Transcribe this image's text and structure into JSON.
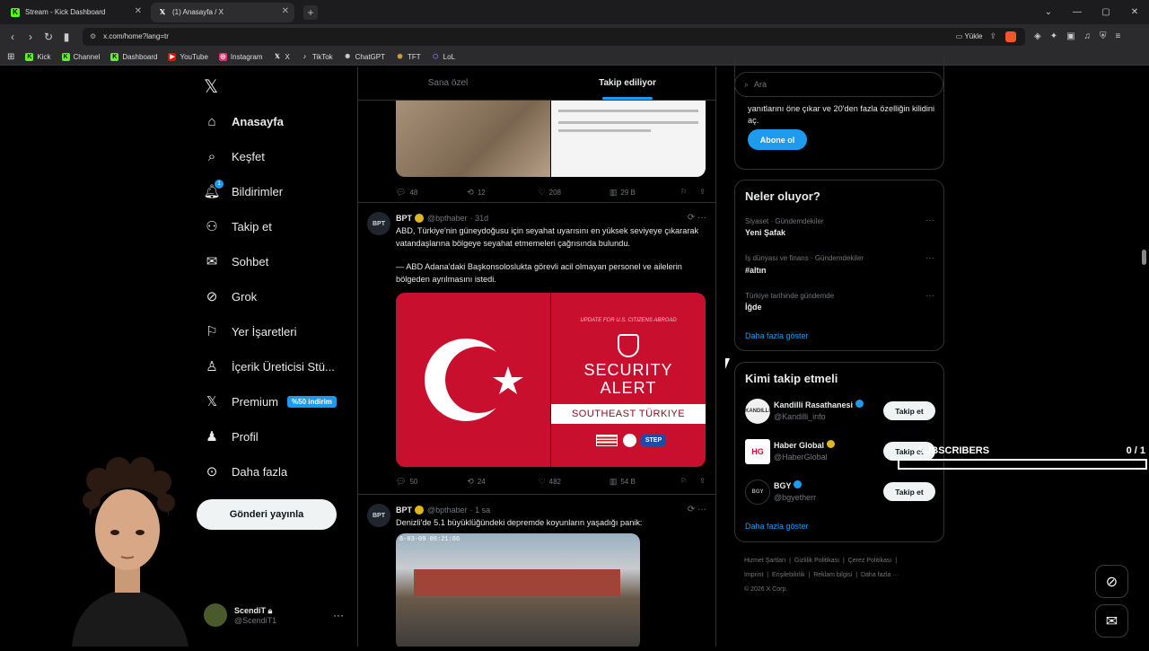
{
  "browser": {
    "tabs": [
      {
        "title": "Stream - Kick Dashboard",
        "icon": "kick-icon",
        "active": false
      },
      {
        "title": "(1) Anasayfa / X",
        "icon": "x-icon",
        "active": true
      }
    ],
    "url": "x.com/home?lang=tr",
    "upload_label": "Yükle",
    "bookmarks": [
      {
        "label": "Kick",
        "color": "#53fc18"
      },
      {
        "label": "Channel",
        "color": "#53fc18"
      },
      {
        "label": "Dashboard",
        "color": "#53fc18"
      },
      {
        "label": "YouTube",
        "color": "#ff0000"
      },
      {
        "label": "Instagram",
        "color": "#e1306c"
      },
      {
        "label": "X",
        "color": "#ffffff"
      },
      {
        "label": "TikTok",
        "color": "#ffffff"
      },
      {
        "label": "ChatGPT",
        "color": "#cccccc"
      },
      {
        "label": "TFT",
        "color": "#c89b3c"
      },
      {
        "label": "LoL",
        "color": "#8a6cff"
      }
    ]
  },
  "sidebar": {
    "items": [
      {
        "label": "Anasayfa",
        "icon": "home-icon"
      },
      {
        "label": "Keşfet",
        "icon": "search-icon"
      },
      {
        "label": "Bildirimler",
        "icon": "bell-icon"
      },
      {
        "label": "Takip et",
        "icon": "follow-icon"
      },
      {
        "label": "Sohbet",
        "icon": "mail-icon"
      },
      {
        "label": "Grok",
        "icon": "grok-icon"
      },
      {
        "label": "Yer İşaretleri",
        "icon": "bookmark-icon"
      },
      {
        "label": "İçerik Üreticisi Stü...",
        "icon": "creator-icon"
      },
      {
        "label": "Premium",
        "icon": "x-icon"
      },
      {
        "label": "Profil",
        "icon": "profile-icon"
      },
      {
        "label": "Daha fazla",
        "icon": "more-icon"
      }
    ],
    "premium_badge": "%50 indirim",
    "notification_count": "1",
    "post_button": "Gönderi yayınla",
    "user": {
      "name": "ScendiT",
      "handle": "@ScendiT1"
    }
  },
  "feed": {
    "tabs": [
      "Sana özel",
      "Takip ediliyor"
    ],
    "tweet0_stats": {
      "reply": "48",
      "retweet": "12",
      "like": "208",
      "views": "29 B"
    },
    "tweets": [
      {
        "author": "BPT",
        "handle": "@bpthaber",
        "time": "· 31d",
        "text1": "ABD, Türkiye'nin güneydoğusu için seyahat uyarısını en yüksek seviyeye çıkararak vatandaşlarına bölgeye seyahat etmemeleri çağrısında bulundu.",
        "text2": "— ABD Adana'daki Başkonsoloslukta görevli acil olmayan personel ve ailelerin bölgeden ayrılmasını istedi.",
        "stats": {
          "reply": "50",
          "retweet": "24",
          "like": "482",
          "views": "54 B"
        },
        "media": {
          "top_label": "UPDATE FOR U.S. CITIZENS ABROAD",
          "line1": "SECURITY",
          "line2": "ALERT",
          "banner": "SOUTHEAST TÜRKIYE",
          "step": "STEP"
        }
      },
      {
        "author": "BPT",
        "handle": "@bpthaber",
        "time": "· 1 sa",
        "text1": "Denizli'de 5.1 büyüklüğündeki depremde koyunların yaşadığı panik:",
        "timestamp_overlay": "6-03-09 09:21:06"
      }
    ]
  },
  "right": {
    "search_placeholder": "Ara",
    "premium_text": "yanıtlarını öne çıkar ve 20'den fazla özelliğin kilidini aç.",
    "subscribe_button": "Abone ol",
    "trends_title": "Neler oluyor?",
    "trends": [
      {
        "category": "Siyaset · Gündemdekiler",
        "name": "Yeni Şafak"
      },
      {
        "category": "İş dünyası ve finans · Gündemdekiler",
        "name": "#altın"
      },
      {
        "category": "Türkiye tarihinde gündemde",
        "name": "İğde"
      }
    ],
    "trends_more": "Daha fazla göster",
    "who_title": "Kimi takip etmeli",
    "who": [
      {
        "name": "Kandilli Rasathanesi",
        "handle": "@Kandilli_info",
        "button": "Takip et",
        "verified": "#1d9bf0"
      },
      {
        "name": "Haber Global",
        "handle": "@HaberGlobal",
        "button": "Takip et",
        "verified": "#e2b719"
      },
      {
        "name": "BGY",
        "handle": "@bgyetherr",
        "button": "Takip et",
        "verified": "#1d9bf0"
      }
    ],
    "who_more": "Daha fazla göster",
    "footer": [
      "Hizmet Şartları",
      "Gizlilik Politikası",
      "Çerez Politikası",
      "Imprint",
      "Erişilebilirlik",
      "Reklam bilgisi",
      "Daha fazla ···",
      "© 2026 X Corp."
    ]
  },
  "overlay": {
    "subs_label": "SUBSCRIBERS",
    "subs_count": "0 / 1",
    "subs_progress": 0
  },
  "colors": {
    "accent": "#1d9bf0",
    "kick": "#53fc18",
    "alert_red": "#c8102e"
  }
}
